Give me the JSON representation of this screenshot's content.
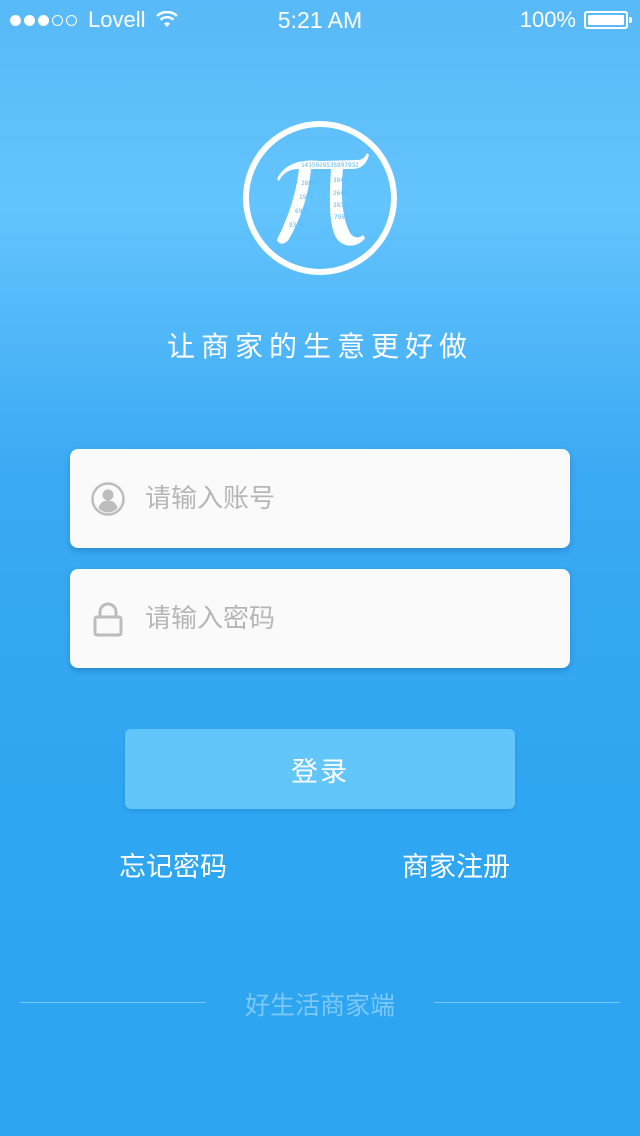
{
  "status_bar": {
    "carrier": "Lovell",
    "time": "5:21 AM",
    "battery": "100%",
    "signal_bars_filled": 3,
    "signal_bars_total": 5
  },
  "logo": {
    "icon": "pi-icon"
  },
  "slogan": "让商家的生意更好做",
  "form": {
    "account_placeholder": "请输入账号",
    "password_placeholder": "请输入密码",
    "login_label": "登录"
  },
  "links": {
    "forgot_password": "忘记密码",
    "merchant_register": "商家注册"
  },
  "footer": {
    "text": "好生活商家端"
  },
  "colors": {
    "background_top": "#58b9f8",
    "background_bottom": "#2ca4f0",
    "login_button": "#63c6fb",
    "field_background": "#fafafa",
    "placeholder": "#b6b6b6"
  }
}
